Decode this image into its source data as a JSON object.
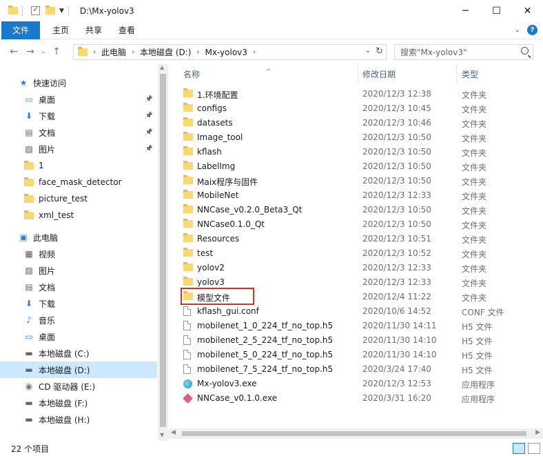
{
  "window": {
    "title": "D:\\Mx-yolov3"
  },
  "ribbon": {
    "tabs": [
      "文件",
      "主页",
      "共享",
      "查看"
    ]
  },
  "address": {
    "crumbs": [
      "此电脑",
      "本地磁盘 (D:)",
      "Mx-yolov3"
    ]
  },
  "search": {
    "placeholder": "搜索\"Mx-yolov3\""
  },
  "columns": {
    "name": "名称",
    "date": "修改日期",
    "type": "类型"
  },
  "sidebar": {
    "quick_access_label": "快速访问",
    "items": [
      {
        "label": "快速访问",
        "icon": "star-icon",
        "level": 0,
        "pinned": false
      },
      {
        "label": "桌面",
        "icon": "desktop-icon",
        "level": 1,
        "pinned": true
      },
      {
        "label": "下载",
        "icon": "download-icon",
        "level": 1,
        "pinned": true
      },
      {
        "label": "文档",
        "icon": "document-icon",
        "level": 1,
        "pinned": true
      },
      {
        "label": "图片",
        "icon": "picture-icon",
        "level": 1,
        "pinned": true
      },
      {
        "label": "1",
        "icon": "folder-icon",
        "level": 1,
        "pinned": false
      },
      {
        "label": "face_mask_detector",
        "icon": "folder-icon",
        "level": 1,
        "pinned": false
      },
      {
        "label": "picture_test",
        "icon": "folder-icon",
        "level": 1,
        "pinned": false
      },
      {
        "label": "xml_test",
        "icon": "folder-icon",
        "level": 1,
        "pinned": false
      },
      {
        "label": "此电脑",
        "icon": "computer-icon",
        "level": 0,
        "pinned": false
      },
      {
        "label": "视频",
        "icon": "video-icon",
        "level": 1,
        "pinned": false
      },
      {
        "label": "图片",
        "icon": "picture-icon",
        "level": 1,
        "pinned": false
      },
      {
        "label": "文档",
        "icon": "document-icon",
        "level": 1,
        "pinned": false
      },
      {
        "label": "下载",
        "icon": "download-icon",
        "level": 1,
        "pinned": false
      },
      {
        "label": "音乐",
        "icon": "music-icon",
        "level": 1,
        "pinned": false
      },
      {
        "label": "桌面",
        "icon": "desktop-icon",
        "level": 1,
        "pinned": false
      },
      {
        "label": "本地磁盘 (C:)",
        "icon": "drive-icon",
        "level": 1,
        "pinned": false
      },
      {
        "label": "本地磁盘 (D:)",
        "icon": "drive-icon",
        "level": 1,
        "pinned": false,
        "selected": true
      },
      {
        "label": "CD 驱动器 (E:)",
        "icon": "cd-drive-icon",
        "level": 1,
        "pinned": false
      },
      {
        "label": "本地磁盘 (F:)",
        "icon": "drive-icon",
        "level": 1,
        "pinned": false
      },
      {
        "label": "本地磁盘 (H:)",
        "icon": "drive-icon",
        "level": 1,
        "pinned": false
      }
    ]
  },
  "files": [
    {
      "name": "1.环境配置",
      "date": "2020/12/3 12:38",
      "type": "文件夹",
      "kind": "folder"
    },
    {
      "name": "configs",
      "date": "2020/12/3 10:45",
      "type": "文件夹",
      "kind": "folder"
    },
    {
      "name": "datasets",
      "date": "2020/12/3 10:46",
      "type": "文件夹",
      "kind": "folder"
    },
    {
      "name": "Image_tool",
      "date": "2020/12/3 10:50",
      "type": "文件夹",
      "kind": "folder"
    },
    {
      "name": "kflash",
      "date": "2020/12/3 10:50",
      "type": "文件夹",
      "kind": "folder"
    },
    {
      "name": "LabelImg",
      "date": "2020/12/3 10:50",
      "type": "文件夹",
      "kind": "folder"
    },
    {
      "name": "Maix程序与固件",
      "date": "2020/12/3 10:50",
      "type": "文件夹",
      "kind": "folder"
    },
    {
      "name": "MobileNet",
      "date": "2020/12/3 12:33",
      "type": "文件夹",
      "kind": "folder"
    },
    {
      "name": "NNCase_v0.2.0_Beta3_Qt",
      "date": "2020/12/3 10:50",
      "type": "文件夹",
      "kind": "folder"
    },
    {
      "name": "NNCase0.1.0_Qt",
      "date": "2020/12/3 10:50",
      "type": "文件夹",
      "kind": "folder"
    },
    {
      "name": "Resources",
      "date": "2020/12/3 10:51",
      "type": "文件夹",
      "kind": "folder"
    },
    {
      "name": "test",
      "date": "2020/12/3 10:52",
      "type": "文件夹",
      "kind": "folder"
    },
    {
      "name": "yolov2",
      "date": "2020/12/3 12:33",
      "type": "文件夹",
      "kind": "folder"
    },
    {
      "name": "yolov3",
      "date": "2020/12/3 12:33",
      "type": "文件夹",
      "kind": "folder"
    },
    {
      "name": "模型文件",
      "date": "2020/12/4 11:22",
      "type": "文件夹",
      "kind": "folder",
      "highlighted": true
    },
    {
      "name": "kflash_gui.conf",
      "date": "2020/10/6 14:52",
      "type": "CONF 文件",
      "kind": "file"
    },
    {
      "name": "mobilenet_1_0_224_tf_no_top.h5",
      "date": "2020/11/30 14:11",
      "type": "H5 文件",
      "kind": "file"
    },
    {
      "name": "mobilenet_2_5_224_tf_no_top.h5",
      "date": "2020/11/30 14:10",
      "type": "H5 文件",
      "kind": "file"
    },
    {
      "name": "mobilenet_5_0_224_tf_no_top.h5",
      "date": "2020/11/30 14:10",
      "type": "H5 文件",
      "kind": "file"
    },
    {
      "name": "mobilenet_7_5_224_tf_no_top.h5",
      "date": "2020/3/24 17:40",
      "type": "H5 文件",
      "kind": "file"
    },
    {
      "name": "Mx-yolov3.exe",
      "date": "2020/12/3 12:53",
      "type": "应用程序",
      "kind": "exe1"
    },
    {
      "name": "NNCase_v0.1.0.exe",
      "date": "2020/3/31 16:20",
      "type": "应用程序",
      "kind": "exe2"
    }
  ],
  "status": {
    "count": "22 个项目"
  },
  "colors": {
    "accent": "#1979ca",
    "selected": "#cce8ff",
    "highlight_box": "#c0392b"
  }
}
